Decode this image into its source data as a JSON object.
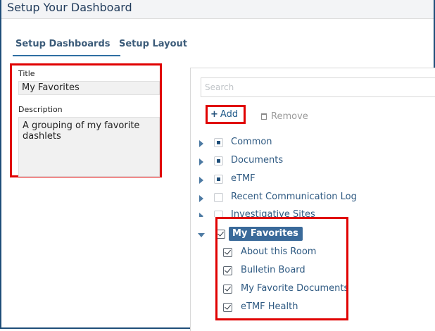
{
  "window": {
    "title": "Setup Your Dashboard"
  },
  "tabs": [
    {
      "label": "Setup Dashboards",
      "active": true
    },
    {
      "label": "Setup Layout",
      "active": false
    }
  ],
  "form": {
    "title_label": "Title",
    "title_value": "My Favorites",
    "description_label": "Description",
    "description_value": "A grouping of my favorite dashlets"
  },
  "search": {
    "placeholder": "Search"
  },
  "toolbar": {
    "add_label": "Add",
    "remove_label": "Remove"
  },
  "tree": {
    "nodes": [
      {
        "label": "Common",
        "state": "partial",
        "expanded": false
      },
      {
        "label": "Documents",
        "state": "partial",
        "expanded": false
      },
      {
        "label": "eTMF",
        "state": "partial",
        "expanded": false
      },
      {
        "label": "Recent Communication Log",
        "state": "unchecked",
        "expanded": false
      },
      {
        "label": "Investigative Sites",
        "state": "unchecked",
        "expanded": false
      },
      {
        "label": "My Favorites",
        "state": "checked",
        "expanded": true,
        "selected": true,
        "children": [
          {
            "label": "About this Room",
            "state": "checked"
          },
          {
            "label": "Bulletin Board",
            "state": "checked"
          },
          {
            "label": "My Favorite Documents",
            "state": "checked"
          },
          {
            "label": "eTMF Health",
            "state": "checked"
          }
        ]
      }
    ]
  },
  "colors": {
    "highlight_border": "#e00000",
    "accent": "#2f6fa3",
    "selected_bg": "#3a6a9a"
  }
}
